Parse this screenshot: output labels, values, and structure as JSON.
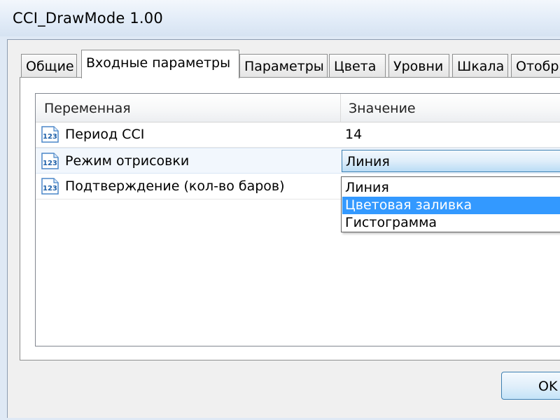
{
  "window": {
    "title": "CCI_DrawMode 1.00"
  },
  "tabs": [
    {
      "label": "Общие"
    },
    {
      "label": "Входные параметры",
      "active": true
    },
    {
      "label": "Параметры"
    },
    {
      "label": "Цвета"
    },
    {
      "label": "Уровни"
    },
    {
      "label": "Шкала"
    },
    {
      "label": "Отобр"
    }
  ],
  "grid": {
    "headers": {
      "variable": "Переменная",
      "value": "Значение"
    },
    "rows": [
      {
        "icon": "numeric-123-icon",
        "name": "Период CCI",
        "value": "14"
      },
      {
        "icon": "numeric-123-icon",
        "name": "Режим отрисовки",
        "value": "Линия"
      },
      {
        "icon": "numeric-123-icon",
        "name": "Подтверждение (кол-во баров)",
        "value": ""
      }
    ]
  },
  "dropdown": {
    "options": [
      "Линия",
      "Цветовая заливка",
      "Гистограмма"
    ],
    "highlighted": "Цветовая заливка"
  },
  "buttons": {
    "ok_label": "OK"
  },
  "colors": {
    "accent": "#3399ff",
    "combo_border": "#3c7fb1"
  }
}
